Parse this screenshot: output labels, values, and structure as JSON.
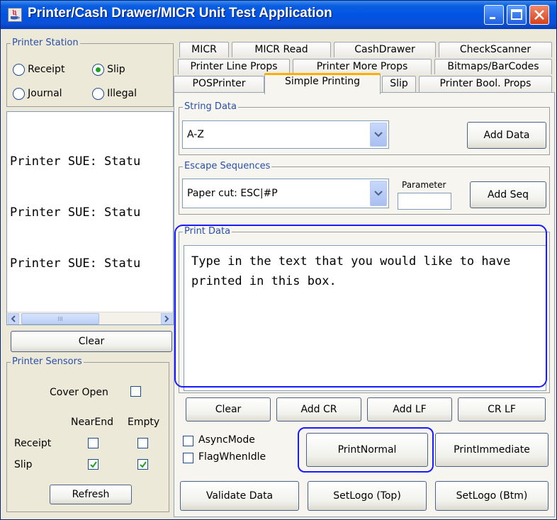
{
  "window": {
    "title": "Printer/Cash Drawer/MICR Unit Test Application"
  },
  "printer_station": {
    "title": "Printer Station",
    "options": [
      {
        "label": "Receipt",
        "selected": false
      },
      {
        "label": "Slip",
        "selected": true
      },
      {
        "label": "Journal",
        "selected": false
      },
      {
        "label": "Illegal",
        "selected": false
      }
    ]
  },
  "log": {
    "lines": [
      "Printer SUE: Statu",
      "Printer SUE: Statu",
      "Printer SUE: Statu"
    ],
    "scroll_grip": "III",
    "clear_label": "Clear"
  },
  "printer_sensors": {
    "title": "Printer Sensors",
    "cover_open_label": "Cover Open",
    "cover_open_checked": false,
    "near_end_label": "NearEnd",
    "empty_label": "Empty",
    "receipt_label": "Receipt",
    "slip_label": "Slip",
    "receipt_near_end": false,
    "receipt_empty": false,
    "slip_near_end": true,
    "slip_empty": true,
    "refresh_label": "Refresh"
  },
  "tabs": {
    "row1": [
      "MICR",
      "MICR Read",
      "CashDrawer",
      "CheckScanner"
    ],
    "row2": [
      "Printer Line Props",
      "Printer More Props",
      "Bitmaps/BarCodes"
    ],
    "row3": [
      "POSPrinter",
      "Simple Printing",
      "Slip",
      "Printer Bool. Props"
    ],
    "active": "Simple Printing"
  },
  "string_data": {
    "title": "String Data",
    "value": "A-Z",
    "add_label": "Add Data"
  },
  "escape_sequences": {
    "title": "Escape Sequences",
    "value": "Paper cut: ESC|#P",
    "parameter_label": "Parameter",
    "parameter_value": "",
    "add_label": "Add Seq"
  },
  "print_data": {
    "title": "Print Data",
    "text": "Type in the text that you would like to have printed in this box."
  },
  "action_buttons": {
    "clear": "Clear",
    "add_cr": "Add CR",
    "add_lf": "Add LF",
    "cr_lf": "CR LF"
  },
  "options": {
    "async_mode_label": "AsyncMode",
    "async_mode_checked": false,
    "flag_when_idle_label": "FlagWhenIdle",
    "flag_when_idle_checked": false
  },
  "print_buttons": {
    "print_normal": "PrintNormal",
    "print_immediate": "PrintImmediate",
    "validate_data": "Validate Data",
    "set_logo_top": "SetLogo (Top)",
    "set_logo_btm": "SetLogo (Btm)"
  },
  "colors": {
    "highlight_outline": "#1a1aff",
    "active_tab_accent": "#ffae00",
    "title_bar": "#0054e3"
  }
}
